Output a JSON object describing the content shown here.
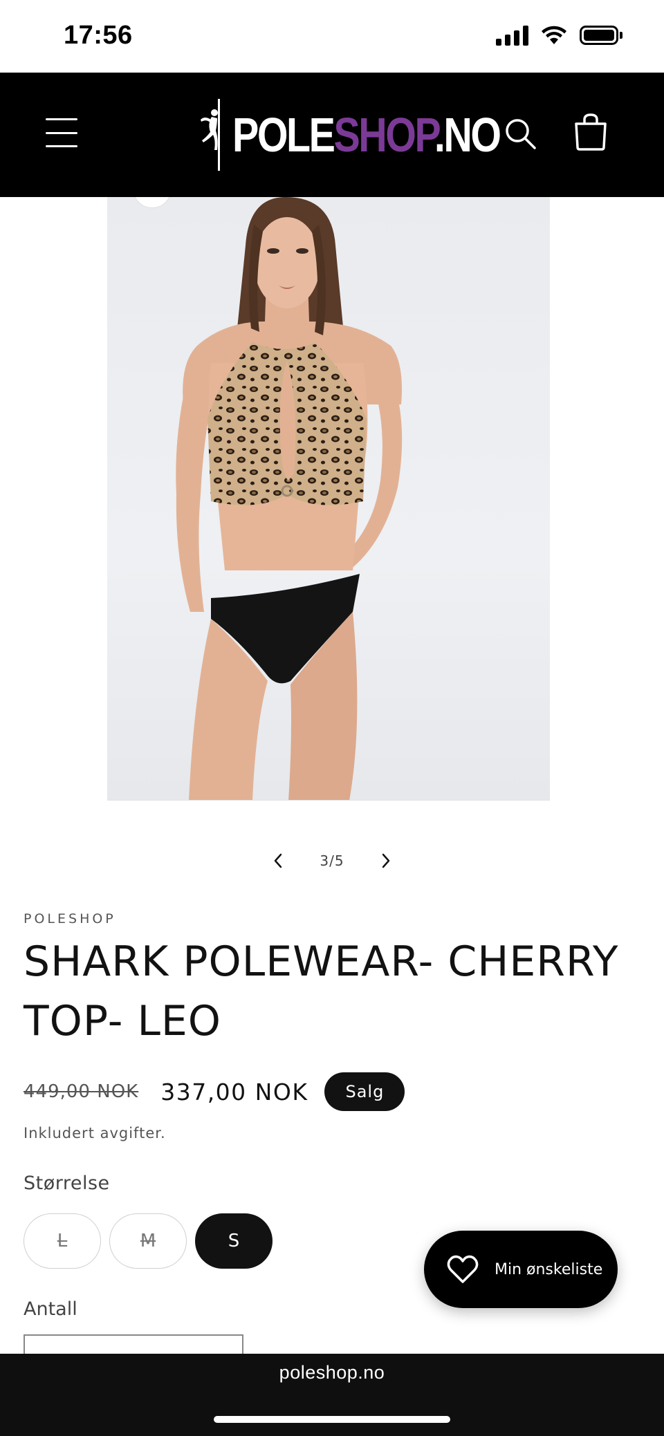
{
  "status_bar": {
    "time": "17:56"
  },
  "header": {
    "logo": {
      "text_white": "POLE",
      "text_purple": "SHOP",
      "text_suffix": ".NO",
      "accent_color": "#7b3a96"
    },
    "icons": [
      "menu-icon",
      "search-icon",
      "cart-icon"
    ]
  },
  "gallery": {
    "counter": "3/5",
    "alt": "Model wearing leopard print halter top with keyhole and black bottoms"
  },
  "product": {
    "vendor": "POLESHOP",
    "title": "SHARK POLEWEAR- CHERRY TOP- LEO",
    "price_original": "449,00 NOK",
    "price_sale": "337,00 NOK",
    "sale_badge": "Salg",
    "tax_note": "Inkludert avgifter.",
    "size_label": "Størrelse",
    "sizes": [
      {
        "label": "L",
        "available": false,
        "selected": false
      },
      {
        "label": "M",
        "available": false,
        "selected": false
      },
      {
        "label": "S",
        "available": true,
        "selected": true
      }
    ],
    "quantity_label": "Antall"
  },
  "wishlist": {
    "label": "Min ønskeliste"
  },
  "browser": {
    "url": "poleshop.no"
  }
}
